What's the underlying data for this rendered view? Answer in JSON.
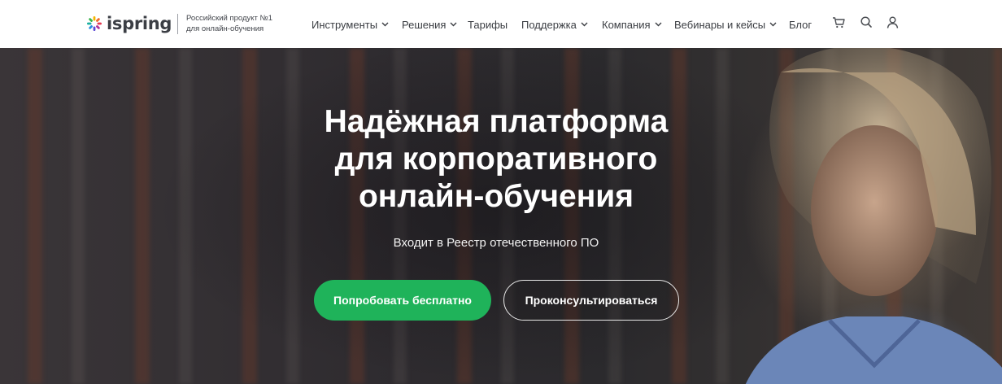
{
  "header": {
    "logo_text": "ispring",
    "tagline_line1": "Российский продукт №1",
    "tagline_line2": "для онлайн-обучения",
    "nav": [
      {
        "label": "Инструменты",
        "has_dropdown": true
      },
      {
        "label": "Решения",
        "has_dropdown": true
      },
      {
        "label": "Тарифы",
        "has_dropdown": false
      },
      {
        "label": "Поддержка",
        "has_dropdown": true
      },
      {
        "label": "Компания",
        "has_dropdown": true
      },
      {
        "label": "Вебинары и кейсы",
        "has_dropdown": true
      },
      {
        "label": "Блог",
        "has_dropdown": false
      }
    ],
    "icons": [
      "cart-icon",
      "search-icon",
      "user-icon"
    ]
  },
  "hero": {
    "title_line1": "Надёжная платформа",
    "title_line2": "для корпоративного",
    "title_line3": "онлайн-обучения",
    "subtitle": "Входит в Реестр отечественного ПО",
    "primary_button": "Попробовать бесплатно",
    "secondary_button": "Проконсультироваться"
  },
  "colors": {
    "accent_green": "#1fb35a",
    "nav_text": "#3a3d42",
    "header_bg": "#ffffff"
  }
}
